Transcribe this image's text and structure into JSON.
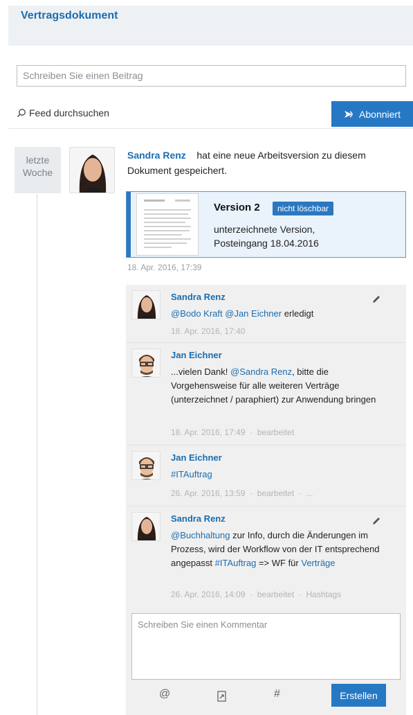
{
  "header": {
    "title": "Vertragsdokument"
  },
  "post_input": {
    "placeholder": "Schreiben Sie einen Beitrag"
  },
  "search": {
    "label": "Feed durchsuchen",
    "icon": "search-icon"
  },
  "subscribe": {
    "label": "Abonniert",
    "icon": "rss-icon"
  },
  "date_badge": {
    "line1": "letzte",
    "line2": "Woche"
  },
  "post": {
    "author": "Sandra Renz",
    "action": "hat eine neue Arbeitsversion zu diesem Dokument gespeichert.",
    "version": {
      "title": "Version 2",
      "badge": "nicht löschbar",
      "desc_line1": "unterzeichnete Version,",
      "desc_line2": "Posteingang 18.04.2016"
    },
    "time": "18. Apr. 2016, 17:39"
  },
  "comments": [
    {
      "author": "Sandra Renz",
      "mention1": "@Bodo Kraft",
      "mention2": "@Jan Eichner",
      "text_rest": " erledigt",
      "time": "18. Apr. 2016, 17:40"
    },
    {
      "author": "Jan Eichner",
      "text_pre": "...vielen Dank! ",
      "mention": "@Sandra Renz",
      "text_post": ", bitte die Vorgehensweise für alle weiteren Verträge (unterzeichnet / paraphiert) zur Anwendung bringen",
      "time": "18. Apr. 2016, 17:49",
      "edited": "bearbeitet"
    },
    {
      "author": "Jan Eichner",
      "hashtag": "#ITAuftrag",
      "time": "26. Apr. 2016, 13:59",
      "edited": "bearbeitet",
      "more": "..."
    },
    {
      "author": "Sandra Renz",
      "mention": "@Buchhaltung",
      "text_mid": " zur Info, durch die Änderungen im Prozess, wird der Workflow von der IT entsprechend angepasst ",
      "hashtag": "#ITAuftrag",
      "text_arrow": " => WF für ",
      "link": "Verträge",
      "time": "26. Apr. 2016, 14:09",
      "edited": "bearbeitet",
      "hashtags": "Hashtags"
    }
  ],
  "comment_box": {
    "placeholder": "Schreiben Sie einen Kommentar"
  },
  "toolbar": {
    "at": "@",
    "hash": "#",
    "create": "Erstellen"
  },
  "colors": {
    "accent": "#2678c4",
    "link": "#1a6db0",
    "header_bg": "#eef1f4"
  }
}
